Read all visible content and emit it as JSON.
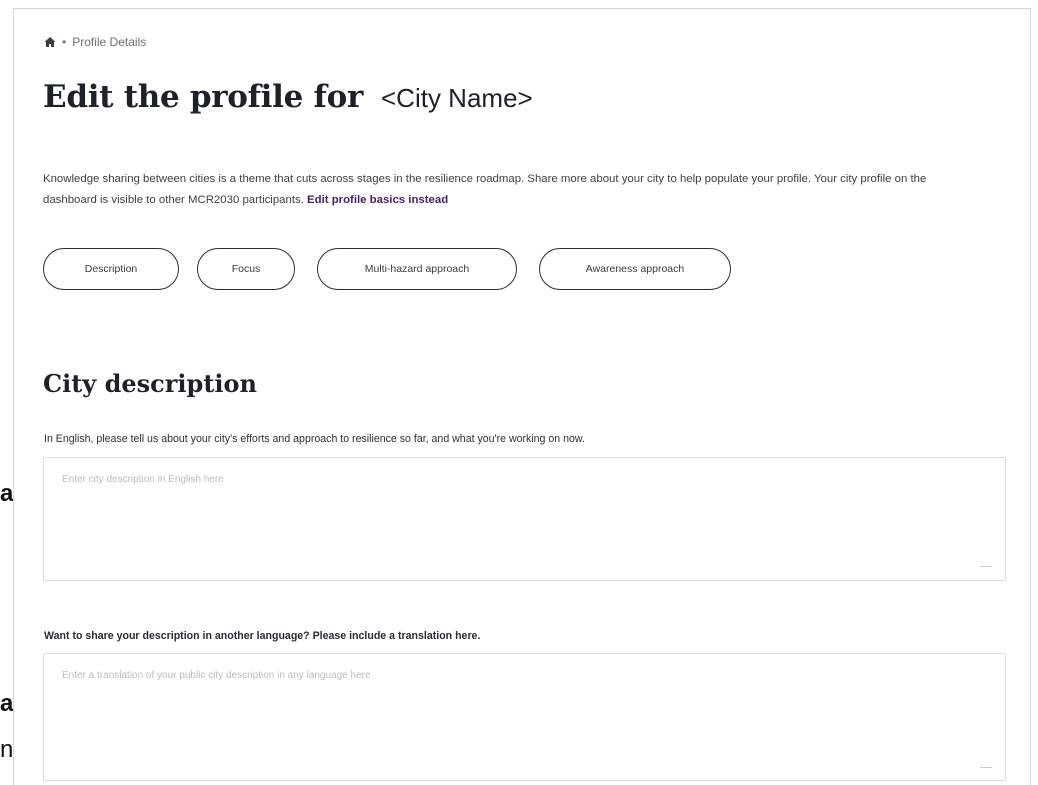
{
  "edge_fragments": {
    "a1": "a",
    "a2": "a",
    "ng": "ng"
  },
  "breadcrumb": {
    "separator": "•",
    "current": "Profile Details"
  },
  "page_title": {
    "main": "Edit the profile for",
    "city": "<City Name>"
  },
  "intro": {
    "text": "Knowledge sharing between cities is a theme that cuts across stages in the resilience roadmap. Share more about your city to help populate your profile. Your city profile on the dashboard is visible to other MCR2030 participants. ",
    "link": "Edit profile basics instead"
  },
  "section_tabs": [
    {
      "label": "Description"
    },
    {
      "label": "Focus"
    },
    {
      "label": "Multi-hazard approach"
    },
    {
      "label": "Awareness approach"
    }
  ],
  "section": {
    "heading": "City description"
  },
  "fields": {
    "english": {
      "label": "In English, please tell us about your city's efforts and approach to resilience so far, and what you're working on now.",
      "placeholder": "Enter city description in English here",
      "value": ""
    },
    "translation": {
      "label": "Want to share your description in another language? Please include a translation here.",
      "placeholder": "Enter a translation of your public city description in any language here",
      "value": ""
    }
  },
  "colors": {
    "accent_link": "#4a1d6b",
    "pill_border": "#2b2d33",
    "card_border": "#d6d6d6"
  }
}
